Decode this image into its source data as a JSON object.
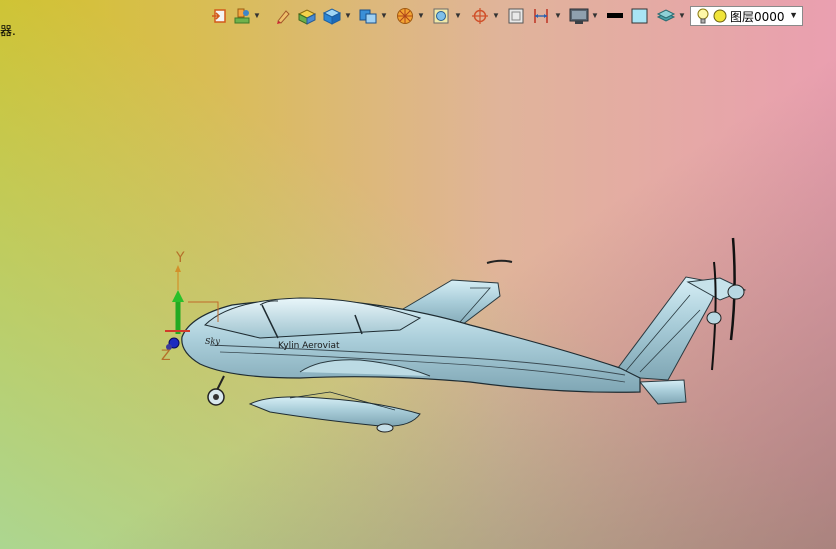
{
  "left_clipped_text": "器.",
  "toolbar": {
    "icons": [
      "insert-icon",
      "layer-tool-icon",
      "pencil-icon",
      "box-solid-icon",
      "cube-blue-icon",
      "view-cube-icon",
      "render-sphere-icon",
      "zoom-fit-icon",
      "snap-target-icon",
      "frame-icon",
      "dimension-icon",
      "monitor-icon",
      "line-color-icon",
      "fill-color-icon",
      "layer-stack-icon"
    ],
    "layer_selector": {
      "name": "图层0000",
      "bulb_icon": "lightbulb-icon",
      "state_icon": "yellow-circle-icon"
    }
  },
  "axes": {
    "y_label": "Y",
    "z_label": "Z"
  },
  "aircraft": {
    "fuselage_text": "Kylin Aeroviat",
    "nose_text": "Sky"
  },
  "colors": {
    "fill_color_swatch": "#a9e4f4",
    "line_color_swatch": "#000000",
    "airframe": "#a9cdd9"
  }
}
